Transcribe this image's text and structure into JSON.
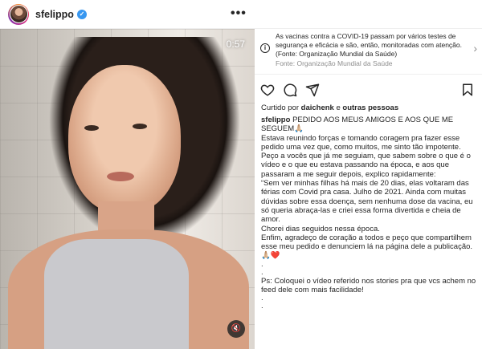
{
  "header": {
    "username": "sfelippo",
    "verified_icon": "verified-badge-icon",
    "more_icon": "more-options-icon",
    "more_label": "•••"
  },
  "video": {
    "timer": "0:57",
    "mute_icon": "muted-speaker-icon",
    "mute_glyph": "🔇"
  },
  "notice": {
    "icon": "info-icon",
    "text": "As vacinas contra a COVID-19 passam por vários testes de segurança e eficácia e são, então, monitoradas com atenção. (Fonte: Organização Mundial da Saúde)",
    "source": "Fonte: Organização Mundial da Saúde",
    "chevron": "›"
  },
  "actions": {
    "like_icon": "heart-icon",
    "comment_icon": "comment-icon",
    "share_icon": "send-icon",
    "save_icon": "bookmark-icon"
  },
  "likes": {
    "prefix": "Curtido por",
    "user": "daichenk",
    "middle": "e",
    "others": "outras pessoas"
  },
  "caption": {
    "username": "sfelippo",
    "lines": [
      "PEDIDO AOS MEUS AMIGOS E AOS QUE ME SEGUEM🙏🏼",
      "Estava reunindo forças e tomando coragem pra fazer esse pedido uma vez que, como muitos, me sinto tão impotente.",
      "Peço a vocês que já me seguiam, que sabem sobre o que é o vídeo e o que eu estava passando na época, e aos que passaram a me seguir depois, explico rapidamente:",
      "“Sem ver minhas filhas há mais de 20 dias, elas voltaram das férias com Covid pra casa. Julho de 2021. Ainda com muitas dúvidas sobre essa doença, sem nenhuma dose da vacina, eu só queria abraça-las e criei essa forma divertida e cheia de amor.",
      "Chorei dias seguidos nessa época.",
      "Enfim, agradeço de coração a todos e peço que compartilhem esse meu pedido e denunciem lá na página dele a publicação. 🙏🏼❤️",
      ".",
      ".",
      "Ps: Coloquei o vídeo referido nos stories pra que vcs achem no feed dele com mais facilidade!",
      ".",
      "."
    ]
  }
}
